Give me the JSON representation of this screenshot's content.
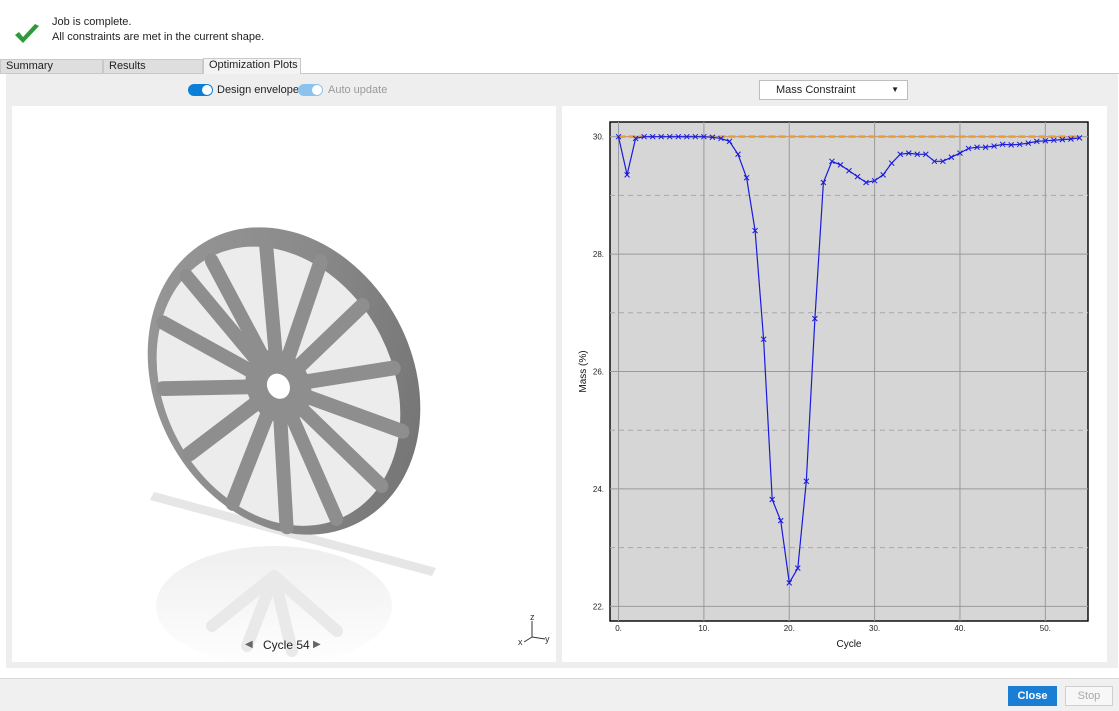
{
  "status": {
    "line1": "Job is complete.",
    "line2": "All constraints are met in the current shape."
  },
  "tabs": [
    {
      "label": "Summary"
    },
    {
      "label": "Results"
    },
    {
      "label": "Optimization Plots",
      "active": true
    }
  ],
  "toggles": {
    "design_envelope": {
      "label": "Design envelope",
      "on": true
    },
    "auto_update": {
      "label": "Auto update",
      "on": true,
      "disabled": true
    }
  },
  "plot_selector": {
    "value": "Mass Constraint"
  },
  "viewport": {
    "cycle_label": "Cycle 54",
    "triad": {
      "z": "z",
      "x": "x",
      "y": "y"
    }
  },
  "buttons": {
    "close": "Close",
    "stop": "Stop"
  },
  "colors": {
    "accent": "#1a7fd4",
    "series": "#1a1adc",
    "limit": "#f39a2a",
    "plot_bg": "#d6d6d6",
    "success": "#2e9a3a"
  },
  "chart_data": {
    "type": "line",
    "xlabel": "Cycle",
    "ylabel": "Mass (%)",
    "xlim": [
      -1,
      55
    ],
    "ylim": [
      21.75,
      30.25
    ],
    "x_ticks": [
      0,
      10,
      20,
      30,
      40,
      50
    ],
    "x_tick_labels": [
      "0.",
      "10.",
      "20.",
      "30.",
      "40.",
      "50."
    ],
    "y_ticks": [
      22,
      24,
      26,
      28,
      30
    ],
    "y_tick_labels": [
      "22.",
      "24.",
      "26.",
      "28.",
      "30."
    ],
    "grid": true,
    "limit": 30.0,
    "series": [
      {
        "x": [
          0,
          1,
          2,
          3,
          4,
          5,
          6,
          7,
          8,
          9,
          10,
          11,
          12,
          13,
          14,
          15,
          16,
          17,
          18,
          19,
          20,
          21,
          22,
          23,
          24,
          25,
          26,
          27,
          28,
          29,
          30,
          31,
          32,
          33,
          34,
          35,
          36,
          37,
          38,
          39,
          40,
          41,
          42,
          43,
          44,
          45,
          46,
          47,
          48,
          49,
          50,
          51,
          52,
          53,
          54
        ],
        "y": [
          30.0,
          29.35,
          29.97,
          30.0,
          30.0,
          30.0,
          30.0,
          30.0,
          30.0,
          30.0,
          30.0,
          29.99,
          29.97,
          29.92,
          29.7,
          29.3,
          28.4,
          26.55,
          23.82,
          23.46,
          22.4,
          22.65,
          24.13,
          26.9,
          29.22,
          29.58,
          29.52,
          29.42,
          29.32,
          29.22,
          29.25,
          29.35,
          29.55,
          29.7,
          29.72,
          29.7,
          29.7,
          29.58,
          29.58,
          29.65,
          29.72,
          29.8,
          29.82,
          29.82,
          29.84,
          29.87,
          29.86,
          29.87,
          29.89,
          29.92,
          29.93,
          29.94,
          29.95,
          29.96,
          29.98
        ]
      }
    ]
  }
}
